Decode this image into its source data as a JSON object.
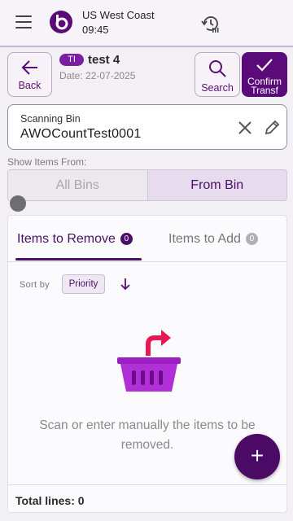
{
  "topbar": {
    "region": "US West Coast",
    "time": "09:45"
  },
  "header": {
    "back_label": "Back",
    "tag": "TI",
    "title": "test 4",
    "date": "Date: 22-07-2025",
    "search_label": "Search",
    "confirm_label": "Confirm Transf"
  },
  "scanning_bin": {
    "label": "Scanning Bin",
    "value": "AWOCountTest0001"
  },
  "show_items": {
    "label": "Show Items From:",
    "options": [
      "All Bins",
      "From Bin"
    ],
    "selected": "From Bin"
  },
  "tabs": [
    {
      "label": "Items to Remove",
      "count": "0",
      "active": true
    },
    {
      "label": "Items to Add",
      "count": "0",
      "active": false
    }
  ],
  "sort": {
    "label": "Sort by",
    "field": "Priority"
  },
  "empty_state": {
    "message": "Scan or enter manually the items to be removed."
  },
  "footer": {
    "total": "Total lines: 0"
  },
  "fab": {
    "symbol": "+"
  },
  "colors": {
    "primary": "#4b0f66",
    "accent": "#7a1fa0",
    "basket": "#b12fd6",
    "arrow": "#e8174f"
  }
}
